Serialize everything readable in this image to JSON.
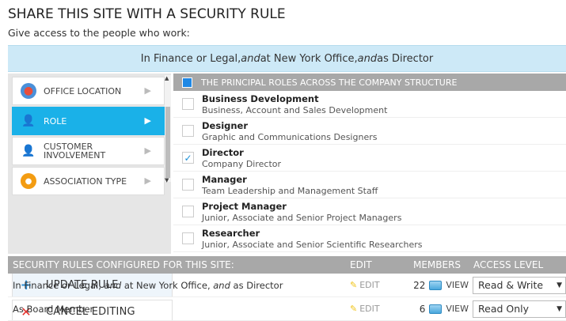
{
  "page": {
    "title": "SHARE THIS SITE WITH A SECURITY RULE",
    "subtitle": "Give access to the people who work:"
  },
  "banner": {
    "part1": "In Finance or Legal, ",
    "and1": "and",
    "part2": " at New York Office, ",
    "and2": "and",
    "part3": " as Director"
  },
  "criteria": [
    {
      "label": "OFFICE LOCATION",
      "icon": "globe-icon",
      "selected": false
    },
    {
      "label": "ROLE",
      "icon": "person-with-briefcase-icon",
      "selected": true
    },
    {
      "label": "CUSTOMER INVOLVEMENT",
      "icon": "customer-icon",
      "selected": false
    },
    {
      "label": "ASSOCIATION TYPE",
      "icon": "association-icon",
      "selected": false
    }
  ],
  "actions": {
    "update": "UPDATE RULE",
    "cancel": "CANCEL EDITING"
  },
  "roles": {
    "header": "THE PRINCIPAL ROLES ACROSS THE COMPANY STRUCTURE",
    "items": [
      {
        "name": "Business Development",
        "desc": "Business, Account and Sales Development",
        "checked": false
      },
      {
        "name": "Designer",
        "desc": "Graphic and Communications Designers",
        "checked": false
      },
      {
        "name": "Director",
        "desc": "Company Director",
        "checked": true
      },
      {
        "name": "Manager",
        "desc": "Team Leadership and Management Staff",
        "checked": false
      },
      {
        "name": "Project Manager",
        "desc": "Junior, Associate and Senior Project Managers",
        "checked": false
      },
      {
        "name": "Researcher",
        "desc": "Junior, Associate and Senior Scientific Researchers",
        "checked": false
      }
    ]
  },
  "table": {
    "headers": {
      "rules": "SECURITY RULES CONFIGURED FOR THIS SITE:",
      "edit": "EDIT",
      "members": "MEMBERS",
      "access": "ACCESS LEVEL"
    },
    "rows": [
      {
        "desc_parts": [
          "In Finance or Legal, ",
          "and",
          " at New York Office, ",
          "and",
          " as Director"
        ],
        "edit": "EDIT",
        "members": "22",
        "view": "VIEW",
        "access": "Read & Write"
      },
      {
        "desc_parts": [
          "As Board Member"
        ],
        "edit": "EDIT",
        "members": "6",
        "view": "VIEW",
        "access": "Read Only"
      }
    ]
  },
  "colors": {
    "accent": "#1ab1e8",
    "banner_bg": "#cde9f7",
    "header_gray": "#a8a8a8",
    "cancel_red": "#e5302b",
    "update_blue": "#2a8fd6"
  }
}
